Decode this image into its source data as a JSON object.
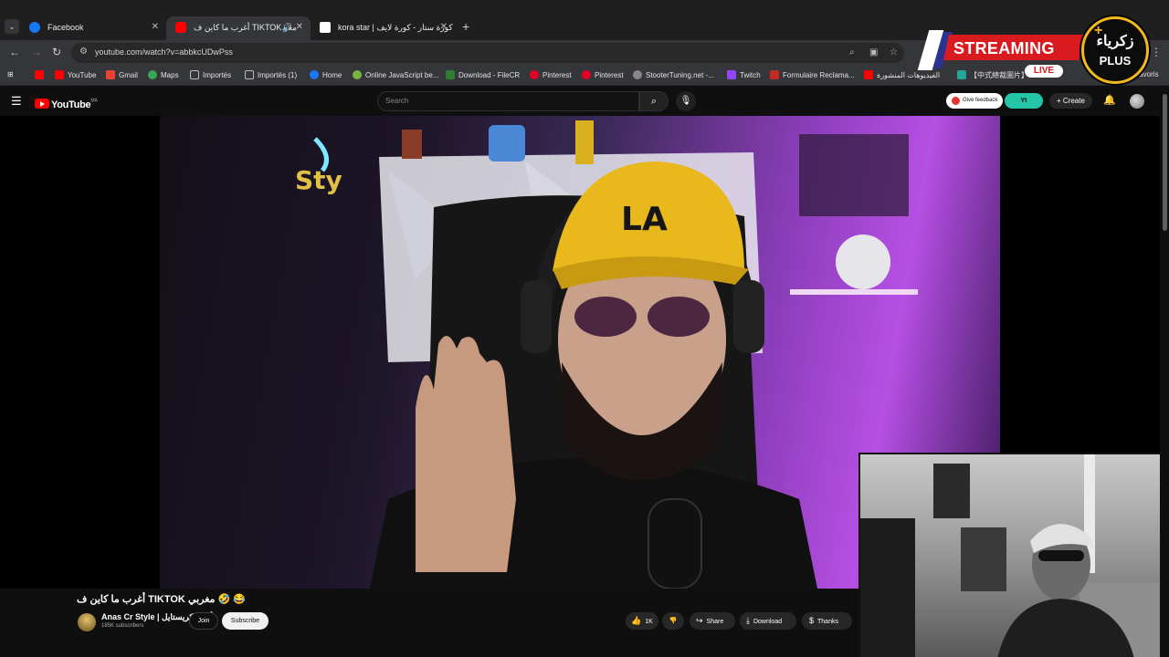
{
  "browser": {
    "tabs": [
      {
        "title": "Facebook",
        "favicon_color": "#1877f2",
        "active": false
      },
      {
        "title": "أغرب ما كاين ف TIKTOK مغر",
        "favicon_color": "#ff0000",
        "active": true,
        "audio_icon": "speaker-icon"
      },
      {
        "title": "kora star | كورة ستار - كورة لايف",
        "favicon_color": "#ffffff",
        "active": false
      }
    ],
    "new_tab_label": "+",
    "url": "youtube.com/watch?v=abbkcUDwPss",
    "bookmarks": [
      {
        "label": "",
        "color": "#ff0000"
      },
      {
        "label": "YouTube",
        "color": "#ff0000"
      },
      {
        "label": "Gmail",
        "color": "#ea4335"
      },
      {
        "label": "Maps",
        "color": "#34a853"
      },
      {
        "label": "Importés",
        "color": "folder"
      },
      {
        "label": "Importés (1)",
        "color": "folder"
      },
      {
        "label": "Home",
        "color": "#1877f2"
      },
      {
        "label": "Online JavaScript be...",
        "color": "#7cb342"
      },
      {
        "label": "Download - FileCR",
        "color": "#2e7d32"
      },
      {
        "label": "Pinterest",
        "color": "#e60023"
      },
      {
        "label": "Pinterest",
        "color": "#e60023"
      },
      {
        "label": "StooterTuning.net -...",
        "color": "#888888"
      },
      {
        "label": "Twitch",
        "color": "#9146ff"
      },
      {
        "label": "Formulaire Reclama...",
        "color": "#c62828"
      },
      {
        "label": "الفيديوهات المنشورة",
        "color": "#ff0000"
      },
      {
        "label": "【中式總裁圖片】3...",
        "color": "#26a69a"
      },
      {
        "label": "favoris",
        "color": "folder"
      }
    ]
  },
  "youtube": {
    "logo_text": "YouTube",
    "logo_region": "MA",
    "search_placeholder": "Search",
    "feedback_label": "Give feedback",
    "extension_label": "Yt",
    "create_label": "Create",
    "video": {
      "title": "أغرب ما كاين ف TIKTOK مغربي 🤣 😂",
      "channel_name": "Anas Cr Style | أناس كريستايل",
      "subscribers": "185K subscribers",
      "join_label": "Join",
      "subscribe_label": "Subscribe",
      "likes": "1K",
      "share_label": "Share",
      "download_label": "Download",
      "thanks_label": "Thanks"
    }
  },
  "overlay": {
    "streaming_text": "STREAMING",
    "live_text": "LIVE",
    "badge_arabic": "زكرياء",
    "badge_plus": "PLUS",
    "accent": "#d91a1f",
    "gold": "#f2b81e"
  }
}
